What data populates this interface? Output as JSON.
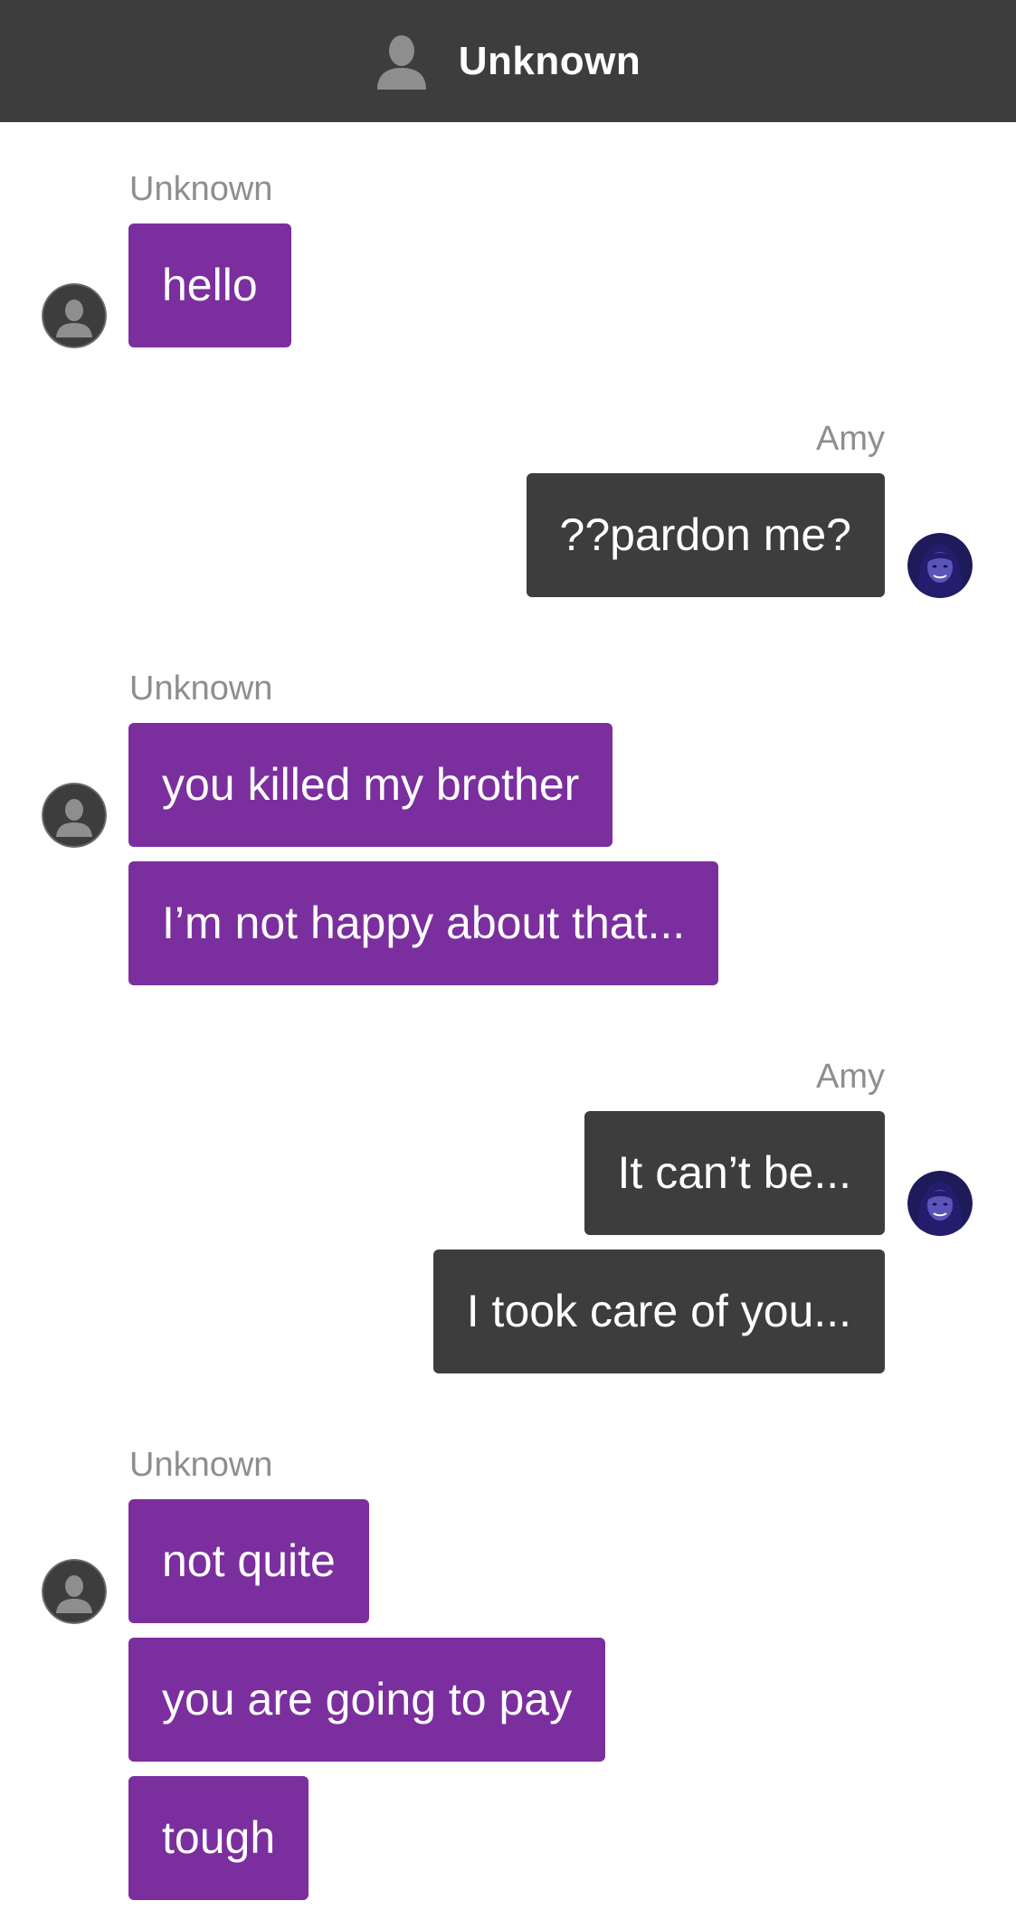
{
  "header": {
    "title": "Unknown",
    "icon": "contact-icon"
  },
  "colors": {
    "header_bg": "#3d3d3d",
    "them_bubble": "#7b2f9e",
    "me_bubble": "#3d3d3d",
    "sender_text": "#8e8e8e"
  },
  "groups": [
    {
      "sender": "Unknown",
      "side": "left",
      "avatar": "unknown-avatar-icon",
      "messages": [
        "hello"
      ]
    },
    {
      "sender": "Amy",
      "side": "right",
      "avatar": "amy-avatar-icon",
      "messages": [
        "??pardon me?"
      ]
    },
    {
      "sender": "Unknown",
      "side": "left",
      "avatar": "unknown-avatar-icon",
      "messages": [
        "you killed my brother",
        "I’m not happy about that..."
      ]
    },
    {
      "sender": "Amy",
      "side": "right",
      "avatar": "amy-avatar-icon",
      "messages": [
        "It can’t be...",
        "I took care of you..."
      ]
    },
    {
      "sender": "Unknown",
      "side": "left",
      "avatar": "unknown-avatar-icon",
      "messages": [
        "not quite",
        "you are going to pay",
        "tough"
      ]
    }
  ]
}
